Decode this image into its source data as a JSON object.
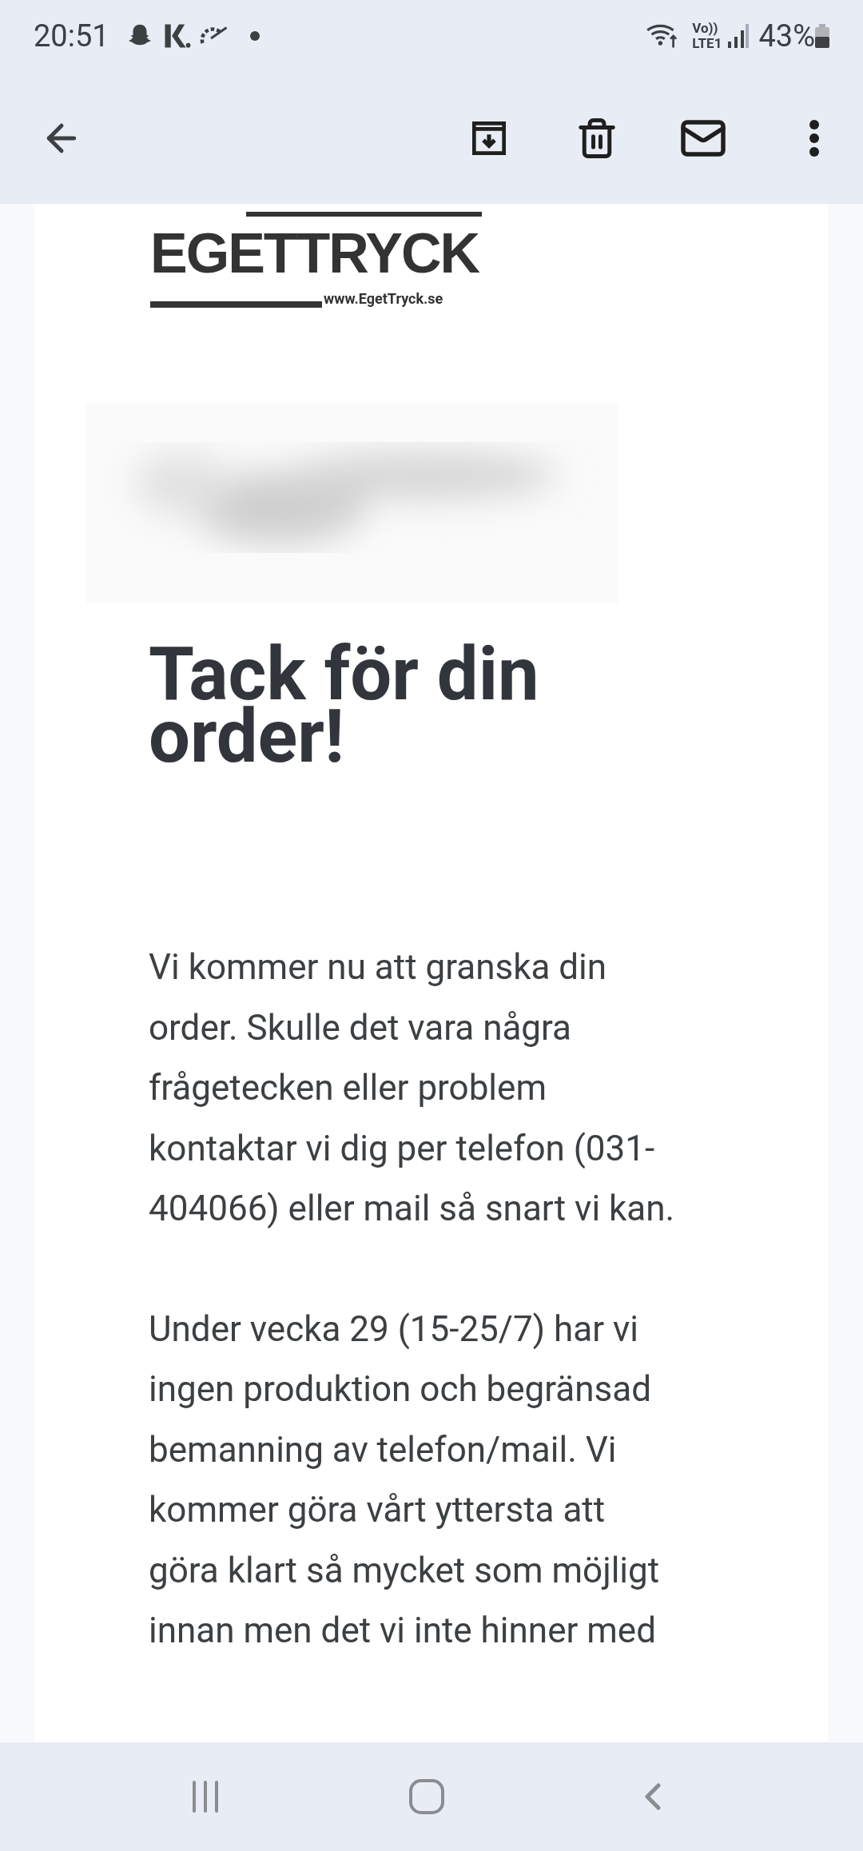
{
  "status_bar": {
    "time": "20:51",
    "network": "Vo))\nLTE1",
    "battery": "43%"
  },
  "logo": {
    "name": "EGETTRYCK",
    "url": "www.EgetTryck.se"
  },
  "heading": "Tack för din order!",
  "paragraphs": [
    "Vi kommer nu att granska din order. Skulle det vara några frågetecken eller problem kontaktar vi dig per telefon (031-404066) eller mail så snart vi kan.",
    "Under vecka 29 (15-25/7) har vi ingen produktion och begränsad bemanning av telefon/mail. Vi kommer göra vårt yttersta att göra klart så mycket som möjligt innan men det vi inte hinner med"
  ]
}
